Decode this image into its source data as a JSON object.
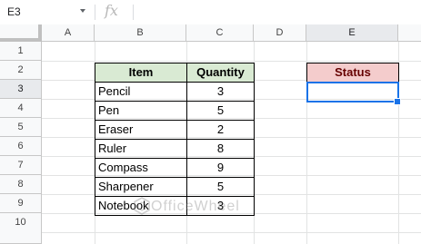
{
  "formula_bar": {
    "cell_ref": "E3",
    "formula_value": ""
  },
  "columns": [
    "A",
    "B",
    "C",
    "D",
    "E"
  ],
  "rows": [
    "1",
    "2",
    "3",
    "4",
    "5",
    "6",
    "7",
    "8",
    "9",
    "10"
  ],
  "table": {
    "headers": {
      "item": "Item",
      "quantity": "Quantity"
    },
    "rows": [
      {
        "item": "Pencil",
        "quantity": "3"
      },
      {
        "item": "Pen",
        "quantity": "5"
      },
      {
        "item": "Eraser",
        "quantity": "2"
      },
      {
        "item": "Ruler",
        "quantity": "8"
      },
      {
        "item": "Compass",
        "quantity": "9"
      },
      {
        "item": "Sharpener",
        "quantity": "5"
      },
      {
        "item": "Notebook",
        "quantity": "3"
      }
    ]
  },
  "status": {
    "header": "Status",
    "value": ""
  },
  "selected_cell": "E3",
  "watermark": "OfficeWheel",
  "colors": {
    "table_header_bg": "#d9ead3",
    "status_header_bg": "#f4cccc",
    "selection": "#1a73e8"
  },
  "icons": {
    "function": "fx-icon",
    "dropdown": "chevron-down-icon"
  }
}
